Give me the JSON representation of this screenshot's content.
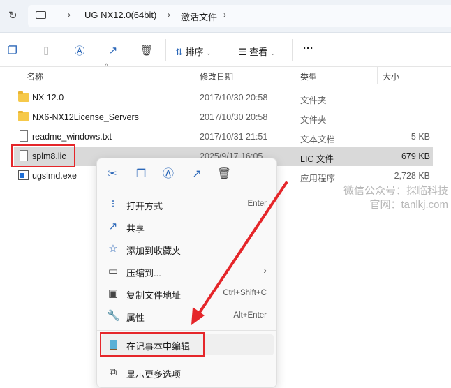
{
  "address": {
    "crumbs": [
      "UG NX12.0(64bit)",
      "激活文件"
    ]
  },
  "toolbar": {
    "sort": "排序",
    "view": "查看",
    "more": "···"
  },
  "columns": [
    "名称",
    "修改日期",
    "类型",
    "大小"
  ],
  "files": [
    {
      "name": "NX 12.0",
      "date": "2017/10/30 20:58",
      "type": "文件夹",
      "size": "",
      "icon": "folder"
    },
    {
      "name": "NX6-NX12License_Servers",
      "date": "2017/10/30 20:58",
      "type": "文件夹",
      "size": "",
      "icon": "folder"
    },
    {
      "name": "readme_windows.txt",
      "date": "2017/10/31 21:51",
      "type": "文本文档",
      "size": "5 KB",
      "icon": "text"
    },
    {
      "name": "splm8.lic",
      "date": "2025/9/17 16:05",
      "type": "LIC 文件",
      "size": "679 KB",
      "icon": "file"
    },
    {
      "name": "ugslmd.exe",
      "date": "",
      "type": "应用程序",
      "size": "2,728 KB",
      "icon": "exe"
    }
  ],
  "context_menu": {
    "items": [
      {
        "label": "打开方式",
        "shortcut": "Enter"
      },
      {
        "label": "共享",
        "shortcut": ""
      },
      {
        "label": "添加到收藏夹",
        "shortcut": ""
      },
      {
        "label": "压缩到...",
        "shortcut": "›"
      },
      {
        "label": "复制文件地址",
        "shortcut": "Ctrl+Shift+C"
      },
      {
        "label": "属性",
        "shortcut": "Alt+Enter"
      },
      {
        "label": "在记事本中编辑",
        "shortcut": ""
      },
      {
        "label": "显示更多选项",
        "shortcut": ""
      }
    ]
  },
  "watermark": {
    "line1": "微信公众号：探临科技",
    "line2": "官网：tanlkj.com"
  },
  "colors": {
    "accent": "#2b67b8",
    "highlight": "#e5262a"
  }
}
